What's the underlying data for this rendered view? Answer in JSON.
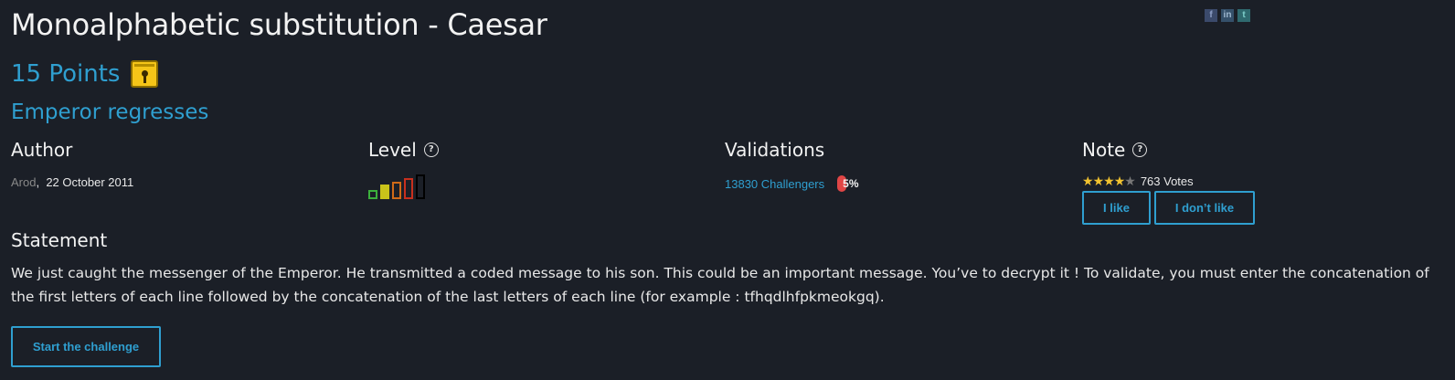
{
  "title": "Monoalphabetic substitution - Caesar",
  "share": {
    "facebook": "f",
    "linkedin": "in",
    "twitter": "t"
  },
  "points": "15 Points",
  "subtitle": "Emperor regresses",
  "author": {
    "heading": "Author",
    "name": "Arod",
    "separator": ",",
    "date": "22 October 2011"
  },
  "level": {
    "heading": "Level",
    "help": "?",
    "current": 2,
    "max": 5
  },
  "validations": {
    "heading": "Validations",
    "challengers": "13830 Challengers",
    "percent": "5%"
  },
  "note": {
    "heading": "Note",
    "help": "?",
    "rating": 4,
    "max": 5,
    "votes": "763 Votes",
    "like_label": "I like",
    "dislike_label": "I don’t like"
  },
  "statement": {
    "heading": "Statement",
    "text": "We just caught the messenger of the Emperor. He transmitted a coded message to his son. This could be an important message. You’ve to decrypt it ! To validate, you must enter the concatenation of the first letters of each line followed by the concatenation of the last letters of each line (for example : tfhqdlhfpkmeokgq)."
  },
  "start_label": "Start the challenge",
  "colors": {
    "accent": "#2f9fd0",
    "background": "#1b1f27"
  }
}
